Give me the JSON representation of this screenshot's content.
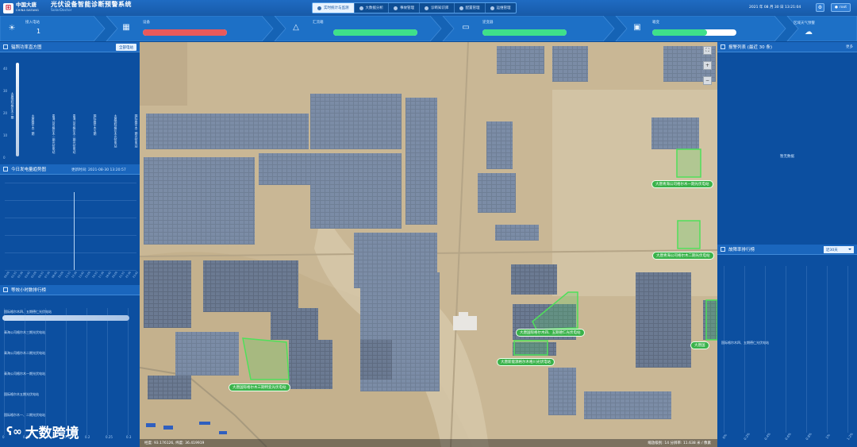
{
  "header": {
    "logo_cn": "中国大唐",
    "logo_en": "CHINA DATANG",
    "title": "光伏设备智能诊断预警系统",
    "subtitle": "SolarDoctor",
    "tabs": [
      {
        "label": "实时统计与监测",
        "active": true
      },
      {
        "label": "大数据分析",
        "active": false
      },
      {
        "label": "事故管理",
        "active": false
      },
      {
        "label": "诊断知识库",
        "active": false
      },
      {
        "label": "配置管理",
        "active": false
      },
      {
        "label": "运维管理",
        "active": false
      }
    ],
    "datetime": "2021 年 08 月 30 日 13:21:04",
    "user": "root"
  },
  "statusbar": {
    "segments": [
      {
        "label": "接入电站",
        "value": "1"
      },
      {
        "label": "设备",
        "fill": 1.0,
        "color": "#e8595b"
      },
      {
        "label": "汇流箱",
        "fill": 1.0,
        "color": "#3ee08a"
      },
      {
        "label": "逆变器",
        "fill": 1.0,
        "color": "#3ee08a"
      },
      {
        "label": "箱变",
        "fill": 0.65,
        "color": "#3ee08a"
      },
      {
        "label": "区域天气预警"
      }
    ]
  },
  "left": {
    "efficiency": {
      "title": "辐照功率直方图",
      "button": "全部电站",
      "y_ticks": [
        "40",
        "30",
        "20",
        "10",
        "0"
      ],
      "bars": [
        "大唐国际格尔木三期",
        "大唐格尔木二期",
        "青海公司格尔木一期光伏电站",
        "青海公司格尔木二期光伏电站",
        "国际格尔木五期",
        "大唐国际格尔木光伏电站",
        "国际格尔木二期光伏电站"
      ]
    },
    "power": {
      "title": "今日发电量趋势图",
      "updated": "更新时间: 2021-08-30 13:20:57",
      "x_ticks": [
        "00:00",
        "01:15",
        "02:30",
        "03:45",
        "05:00",
        "06:15",
        "07:30",
        "08:45",
        "10:00",
        "11:15",
        "12:30",
        "13:45",
        "15:00",
        "16:15",
        "17:30",
        "18:45",
        "20:00",
        "21:15",
        "22:30",
        "23:45"
      ]
    },
    "hours": {
      "title": "等效小时数排行榜",
      "items": [
        "国际格尔木四、五期德仁光伏电站",
        "青海公司格尔木三期光伏电站",
        "青海公司格尔木二期光伏电站",
        "青海公司格尔木一期光伏电站",
        "国际格尔木五期光伏电站",
        "国际格尔木一、二期光伏电站"
      ],
      "x_ticks": [
        "0",
        "0.05",
        "0.1",
        "0.15",
        "0.2",
        "0.25",
        "0.3"
      ]
    }
  },
  "right": {
    "alarms": {
      "title": "报警列表 (最近 30 条)",
      "more": "更多",
      "empty": "暂无数据"
    },
    "fault": {
      "title": "故障率排行榜",
      "select": "近30天",
      "item": "国际格尔木四、五期德仁光伏电站",
      "x_ticks": [
        "0%",
        "0.2%",
        "0.4%",
        "0.6%",
        "0.8%",
        "1%",
        "1.2%"
      ]
    }
  },
  "map": {
    "stations": [
      "大唐青海公司格尔木一期光伏电站",
      "大唐青海公司格尔木二期光伏电站",
      "大唐国际格尔木四、五期德仁光伏电站",
      "大唐新能源格尔木格川光伏电站",
      "大唐国际格尔木三期特变光伏电站",
      "大唐国"
    ],
    "footer_left": "经度: 93.176126,  纬度: 36.419919",
    "footer_right": "缩放级别: 14  分辨率: 11.638 米 / 像素"
  },
  "watermark": "大数跨境"
}
